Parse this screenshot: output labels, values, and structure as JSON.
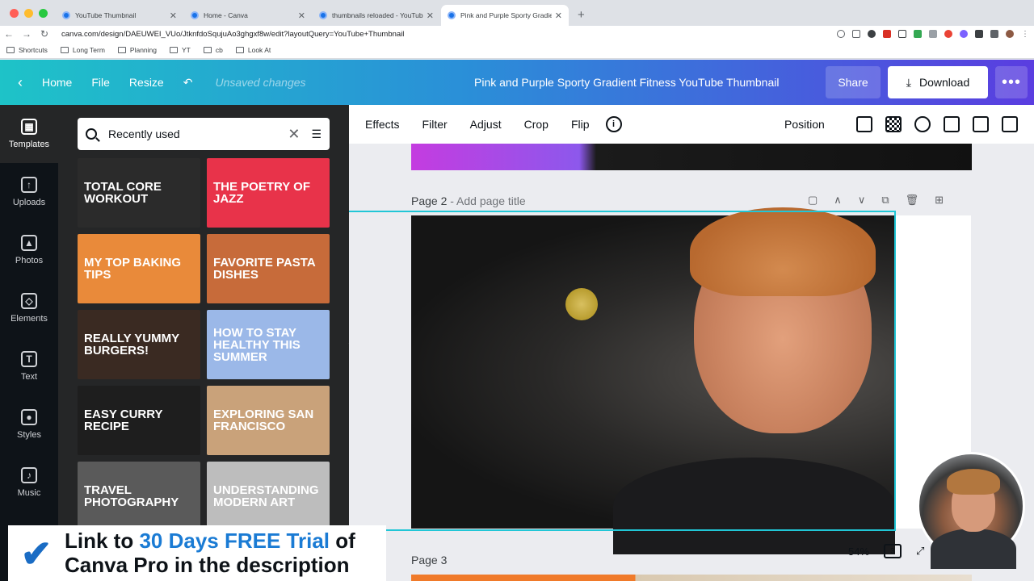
{
  "browser": {
    "tabs": [
      {
        "title": "YouTube Thumbnail",
        "active": false
      },
      {
        "title": "Home - Canva",
        "active": false
      },
      {
        "title": "thumbnails reloaded - YouTube",
        "active": false
      },
      {
        "title": "Pink and Purple Sporty Gradient",
        "active": true
      }
    ],
    "new_tab": "+",
    "url": "canva.com/design/DAEUWEI_VUo/JtknfdoSqujuAo3ghgxf8w/edit?layoutQuery=YouTube+Thumbnail",
    "bookmarks": [
      "Shortcuts",
      "Long Term",
      "Planning",
      "YT",
      "cb",
      "Look At"
    ]
  },
  "header": {
    "home": "Home",
    "file": "File",
    "resize": "Resize",
    "unsaved": "Unsaved changes",
    "title": "Pink and Purple Sporty Gradient Fitness YouTube Thumbnail",
    "share": "Share",
    "download": "Download",
    "more": "•••"
  },
  "rail": [
    {
      "label": "Templates",
      "icon": "templates-icon",
      "glyph": "▦"
    },
    {
      "label": "Uploads",
      "icon": "cloud-upload-icon",
      "glyph": "↑"
    },
    {
      "label": "Photos",
      "icon": "photo-icon",
      "glyph": "▲"
    },
    {
      "label": "Elements",
      "icon": "shapes-icon",
      "glyph": "◇"
    },
    {
      "label": "Text",
      "icon": "text-icon",
      "glyph": "T"
    },
    {
      "label": "Styles",
      "icon": "palette-icon",
      "glyph": "●"
    },
    {
      "label": "Music",
      "icon": "music-note-icon",
      "glyph": "♪"
    }
  ],
  "panel": {
    "search_value": "Recently used",
    "templates": [
      {
        "text": "Total Core Workout",
        "bg": "#2b2b2b",
        "fg": "#ffffff"
      },
      {
        "text": "The Poetry of Jazz",
        "bg": "#e8334a",
        "fg": "#ffffff"
      },
      {
        "text": "My Top Baking Tips",
        "bg": "#e98a3a",
        "fg": "#ffffff"
      },
      {
        "text": "Favorite Pasta Dishes",
        "bg": "#c76b3a",
        "fg": "#ffffff"
      },
      {
        "text": "really yummy burgers!",
        "bg": "#3a2a22",
        "fg": "#ffffff"
      },
      {
        "text": "How to Stay Healthy This Summer",
        "bg": "#9bb8e8",
        "fg": "#ffffff"
      },
      {
        "text": "Easy Curry Recipe",
        "bg": "#1e1e1e",
        "fg": "#ffffff"
      },
      {
        "text": "Exploring San Francisco",
        "bg": "#c9a27a",
        "fg": "#ffffff"
      },
      {
        "text": "Travel Photography",
        "bg": "#5a5a5a",
        "fg": "#ffffff"
      },
      {
        "text": "Understanding Modern Art",
        "bg": "#bdbdbd",
        "fg": "#ffffff"
      }
    ]
  },
  "toolbar": {
    "effects": "Effects",
    "filter": "Filter",
    "adjust": "Adjust",
    "crop": "Crop",
    "flip": "Flip",
    "info": "i",
    "position": "Position"
  },
  "canvas": {
    "page2_label": "Page 2",
    "page2_sub": " - Add page title",
    "page3_label": "Page 3",
    "zoom": "54%",
    "page_count": "3"
  },
  "banner": {
    "line1_a": "Link to ",
    "line1_b": "30 Days FREE Trial",
    "line1_c": " of",
    "line2": "Canva Pro in the description"
  },
  "colors": {
    "accent_teal": "#1ec3c8",
    "accent_purple": "#5a3de0",
    "selection": "#21c6d6",
    "banner_highlight": "#1a7bd4"
  }
}
